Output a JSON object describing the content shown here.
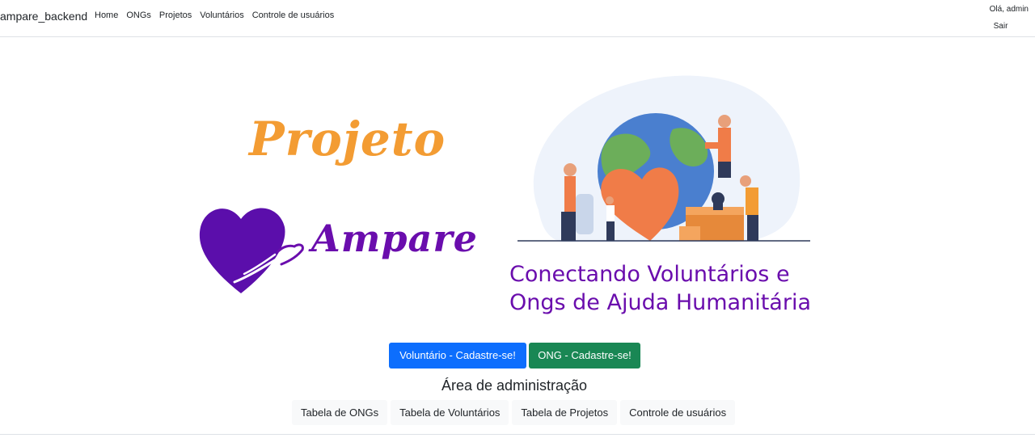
{
  "navbar": {
    "brand": "ampare_backend",
    "links": [
      "Home",
      "ONGs",
      "Projetos",
      "Voluntários",
      "Controle de usuários"
    ],
    "greeting": "Olá, admin",
    "logout": "Sair"
  },
  "hero": {
    "logo_top": "Projeto",
    "logo_bottom": "Ampare",
    "tagline_line1": "Conectando Voluntários e",
    "tagline_line2": "Ongs de Ajuda Humanitária"
  },
  "actions": {
    "volunteer_signup": "Voluntário - Cadastre-se!",
    "ong_signup": "ONG - Cadastre-se!"
  },
  "admin": {
    "title": "Área de administração",
    "buttons": [
      "Tabela de ONGs",
      "Tabela de Voluntários",
      "Tabela de Projetos",
      "Controle de usuários"
    ]
  },
  "colors": {
    "orange": "#f39c33",
    "purple": "#6a0dad",
    "primary": "#0d6efd",
    "success": "#198754",
    "light": "#f8f9fa"
  },
  "icons": {
    "logo": "heart-hand-icon",
    "illustration": "globe-heart-volunteers-illustration"
  }
}
